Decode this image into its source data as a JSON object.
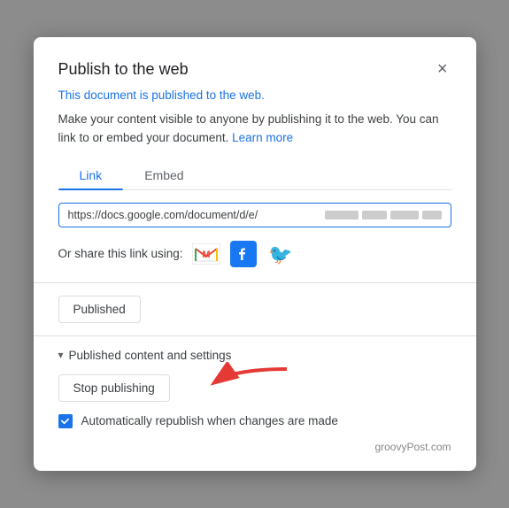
{
  "modal": {
    "title": "Publish to the web",
    "close_label": "×",
    "published_notice": "This document is published to the web.",
    "description_text": "Make your content visible to anyone by publishing it to the web. You can link to or embed your document.",
    "learn_more_label": "Learn more",
    "tabs": [
      {
        "label": "Link",
        "active": true
      },
      {
        "label": "Embed",
        "active": false
      }
    ],
    "url_value": "https://docs.google.com/document/d/e/",
    "share_label": "Or share this link using:",
    "published_btn_label": "Published",
    "settings_header": "Published content and settings",
    "stop_btn_label": "Stop publishing",
    "checkbox_label": "Automatically republish when changes are made",
    "watermark": "groovyPost.com"
  }
}
